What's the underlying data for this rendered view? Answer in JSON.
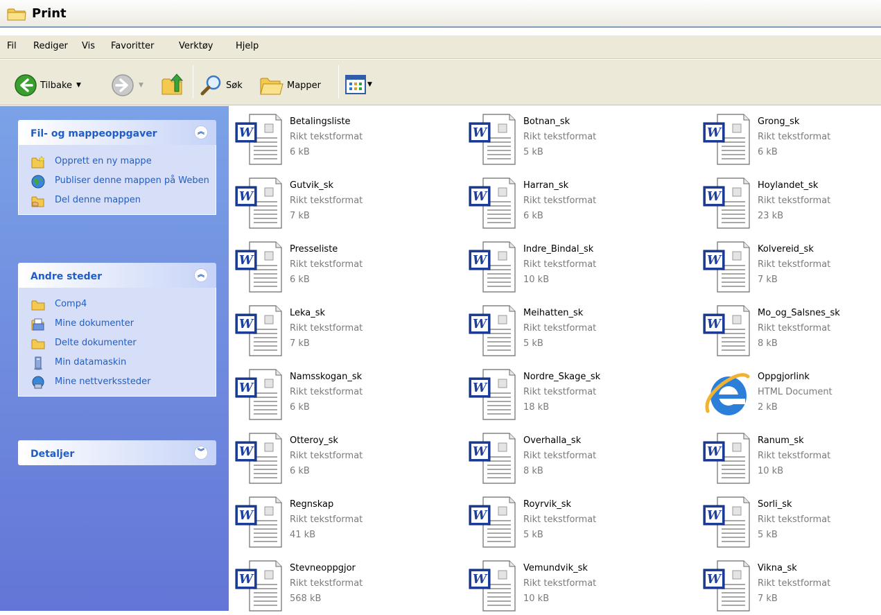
{
  "window": {
    "title": "Print"
  },
  "menu": [
    "Fil",
    "Rediger",
    "Vis",
    "Favoritter",
    "Verktøy",
    "Hjelp"
  ],
  "toolbar": {
    "back_label": "Tilbake",
    "search_label": "Søk",
    "folders_label": "Mapper"
  },
  "sidebar": {
    "tasks": {
      "title": "Fil- og mappeoppgaver",
      "items": [
        "Opprett en ny mappe",
        "Publiser denne mappen på Weben",
        "Del denne mappen"
      ]
    },
    "places": {
      "title": "Andre steder",
      "items": [
        "Comp4",
        "Mine dokumenter",
        "Delte dokumenter",
        "Min datamaskin",
        "Mine nettverkssteder"
      ]
    },
    "details": {
      "title": "Detaljer"
    }
  },
  "files": [
    {
      "name": "Betalingsliste",
      "type": "Rikt tekstformat",
      "size": "6 kB",
      "icon": "word-document-icon"
    },
    {
      "name": "Botnan_sk",
      "type": "Rikt tekstformat",
      "size": "5 kB",
      "icon": "word-document-icon"
    },
    {
      "name": "Grong_sk",
      "type": "Rikt tekstformat",
      "size": "6 kB",
      "icon": "word-document-icon"
    },
    {
      "name": "Gutvik_sk",
      "type": "Rikt tekstformat",
      "size": "7 kB",
      "icon": "word-document-icon"
    },
    {
      "name": "Harran_sk",
      "type": "Rikt tekstformat",
      "size": "6 kB",
      "icon": "word-document-icon"
    },
    {
      "name": "Hoylandet_sk",
      "type": "Rikt tekstformat",
      "size": "23 kB",
      "icon": "word-document-icon"
    },
    {
      "name": "Presseliste",
      "type": "Rikt tekstformat",
      "size": "6 kB",
      "icon": "word-document-icon"
    },
    {
      "name": "Indre_Bindal_sk",
      "type": "Rikt tekstformat",
      "size": "10 kB",
      "icon": "word-document-icon"
    },
    {
      "name": "Kolvereid_sk",
      "type": "Rikt tekstformat",
      "size": "7 kB",
      "icon": "word-document-icon"
    },
    {
      "name": "Leka_sk",
      "type": "Rikt tekstformat",
      "size": "7 kB",
      "icon": "word-document-icon"
    },
    {
      "name": "Meihatten_sk",
      "type": "Rikt tekstformat",
      "size": "5 kB",
      "icon": "word-document-icon"
    },
    {
      "name": "Mo_og_Salsnes_sk",
      "type": "Rikt tekstformat",
      "size": "8 kB",
      "icon": "word-document-icon"
    },
    {
      "name": "Namsskogan_sk",
      "type": "Rikt tekstformat",
      "size": "6 kB",
      "icon": "word-document-icon"
    },
    {
      "name": "Nordre_Skage_sk",
      "type": "Rikt tekstformat",
      "size": "18 kB",
      "icon": "word-document-icon"
    },
    {
      "name": "Oppgjorlink",
      "type": "HTML Document",
      "size": "2 kB",
      "icon": "internet-explorer-icon"
    },
    {
      "name": "Otteroy_sk",
      "type": "Rikt tekstformat",
      "size": "6 kB",
      "icon": "word-document-icon"
    },
    {
      "name": "Overhalla_sk",
      "type": "Rikt tekstformat",
      "size": "8 kB",
      "icon": "word-document-icon"
    },
    {
      "name": "Ranum_sk",
      "type": "Rikt tekstformat",
      "size": "10 kB",
      "icon": "word-document-icon"
    },
    {
      "name": "Regnskap",
      "type": "Rikt tekstformat",
      "size": "41 kB",
      "icon": "word-document-icon"
    },
    {
      "name": "Royrvik_sk",
      "type": "Rikt tekstformat",
      "size": "5 kB",
      "icon": "word-document-icon"
    },
    {
      "name": "Sorli_sk",
      "type": "Rikt tekstformat",
      "size": "5 kB",
      "icon": "word-document-icon"
    },
    {
      "name": "Stevneoppgjor",
      "type": "Rikt tekstformat",
      "size": "568 kB",
      "icon": "word-document-icon"
    },
    {
      "name": "Vemundvik_sk",
      "type": "Rikt tekstformat",
      "size": "10 kB",
      "icon": "word-document-icon"
    },
    {
      "name": "Vikna_sk",
      "type": "Rikt tekstformat",
      "size": "7 kB",
      "icon": "word-document-icon"
    }
  ]
}
